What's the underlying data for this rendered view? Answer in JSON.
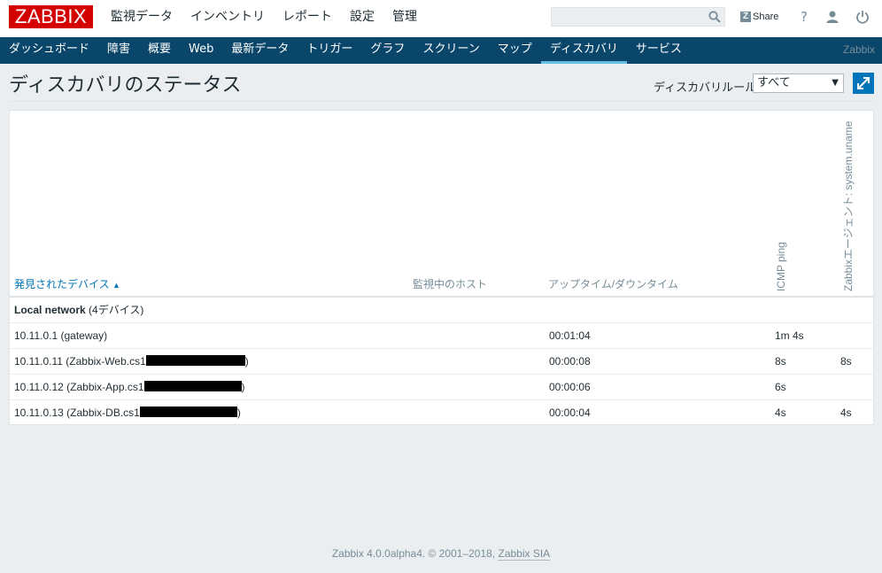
{
  "header": {
    "logo": "ZABBIX",
    "main_menu": [
      "監視データ",
      "インベントリ",
      "レポート",
      "設定",
      "管理"
    ],
    "search_value": "",
    "share_label": "Share",
    "help_label": "?"
  },
  "subnav": {
    "items": [
      "ダッシュボード",
      "障害",
      "概要",
      "Web",
      "最新データ",
      "トリガー",
      "グラフ",
      "スクリーン",
      "マップ",
      "ディスカバリ",
      "サービス"
    ],
    "active_index": 9,
    "brand": "Zabbix"
  },
  "page": {
    "title": "ディスカバリのステータス",
    "filter_label": "ディスカバリルール",
    "filter_value": "すべて"
  },
  "table": {
    "headers": {
      "device": "発見されたデバイス",
      "host": "監視中のホスト",
      "uptime": "アップタイム/ダウンタイム",
      "icmp": "ICMP ping",
      "agent": "Zabbixエージェント: system.uname"
    },
    "group": {
      "name": "Local network",
      "count": "(4デバイス)"
    },
    "rows": [
      {
        "device_prefix": "10.11.0.1 (gateway)",
        "device_suffix": "",
        "uptime": "00:01:04",
        "icmp": "1m 4s",
        "agent": ""
      },
      {
        "device_prefix": "10.11.0.11 (Zabbix-Web.cs1",
        "device_suffix": ")",
        "uptime": "00:00:08",
        "icmp": "8s",
        "agent": "8s"
      },
      {
        "device_prefix": "10.11.0.12 (Zabbix-App.cs1",
        "device_suffix": ")",
        "uptime": "00:00:06",
        "icmp": "6s",
        "agent": ""
      },
      {
        "device_prefix": "10.11.0.13 (Zabbix-DB.cs1",
        "device_suffix": ")",
        "uptime": "00:00:04",
        "icmp": "4s",
        "agent": "4s"
      }
    ]
  },
  "footer": {
    "text": "Zabbix 4.0.0alpha4. © 2001–2018,",
    "link": "Zabbix SIA"
  },
  "colors": {
    "logo_red": "#d40000",
    "subnav_bg": "#0a466a",
    "active_tab": "#65bfe5",
    "link_blue": "#0275b8"
  }
}
